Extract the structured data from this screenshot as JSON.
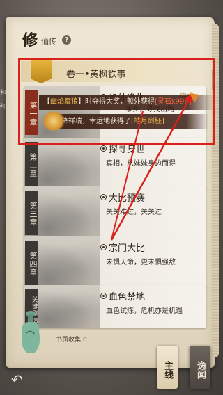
{
  "header": {
    "title": "修",
    "subtitle": "仙传",
    "help": "?"
  },
  "side_labels": [
    "包",
    "红包"
  ],
  "volume": {
    "title": "卷一•黄枫铁事"
  },
  "chapters": [
    {
      "tag": "第一章",
      "name": "绝外逢生",
      "status": "完成",
      "desc_visible": "家乡，寻找出路",
      "active": true
    },
    {
      "tag": "第二章",
      "name": "探寻身世",
      "desc": "真相，从妹妹身边而得"
    },
    {
      "tag": "第三章",
      "name": "大比预赛",
      "desc": "关关难过，关关过"
    },
    {
      "tag": "第四章",
      "name": "宗门大比",
      "desc": "未惧天命，更未惧强敌"
    },
    {
      "tag": "关键剧情",
      "name": "血色禁地",
      "desc": "血色试炼，危机亦是机遇"
    }
  ],
  "notifications": [
    {
      "prefix": "【",
      "name": "幽焰魔狼",
      "mid": "】时夺得大奖，额外获得",
      "reward": "[灵石x999]"
    },
    {
      "prefix": "降祥瑞，幸运地获得了",
      "reward": "[皓月剑胚]"
    }
  ],
  "footer": {
    "collection": "书页收集:0",
    "main_line": "主线",
    "side_story": "逸闻"
  },
  "colors": {
    "highlight_red": "#d9201a",
    "gold": "#e8b34a",
    "arrow": "#d9201a"
  }
}
